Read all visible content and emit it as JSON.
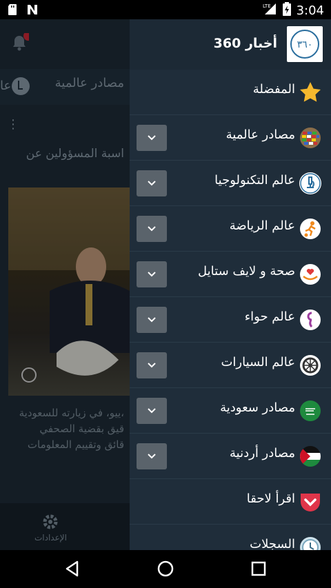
{
  "status": {
    "time": "3:04",
    "network": "LTE"
  },
  "background": {
    "tab_1": "مصادر عالمية",
    "tab_2": "عا",
    "headline": "اسبة المسؤولين عن",
    "body_lines": [
      "ييو، في زيارته للسعودية،",
      "قيق بقضية الصحفي",
      "قائق وتقييم المعلومات"
    ],
    "settings_label": "الإعدادات"
  },
  "drawer": {
    "title": "أخبار 360",
    "logo_text": "٣٦٠",
    "items": [
      {
        "label": "المفضلة",
        "icon": "star-icon",
        "expandable": false
      },
      {
        "label": "مصادر عالمية",
        "icon": "world-flags-icon",
        "expandable": true
      },
      {
        "label": "عالم التكنولوجيا",
        "icon": "microscope-icon",
        "expandable": true
      },
      {
        "label": "عالم الرياضة",
        "icon": "soccer-player-icon",
        "expandable": true
      },
      {
        "label": "صحة و لايف ستايل",
        "icon": "heart-hand-icon",
        "expandable": true
      },
      {
        "label": "عالم حواء",
        "icon": "female-symbol-icon",
        "expandable": true
      },
      {
        "label": "عالم السيارات",
        "icon": "wheel-icon",
        "expandable": true
      },
      {
        "label": "مصادر سعودية",
        "icon": "saudi-flag-icon",
        "expandable": true
      },
      {
        "label": "مصادر أردنية",
        "icon": "jordan-flag-icon",
        "expandable": true
      },
      {
        "label": "اقرأ لاحقا",
        "icon": "pocket-icon",
        "expandable": false
      },
      {
        "label": "السجلات",
        "icon": "clock-icon",
        "expandable": false
      }
    ]
  },
  "colors": {
    "drawer_bg": "#1f2d3a",
    "expand_btn": "#5a636b",
    "accent_red": "#d42a3a"
  }
}
